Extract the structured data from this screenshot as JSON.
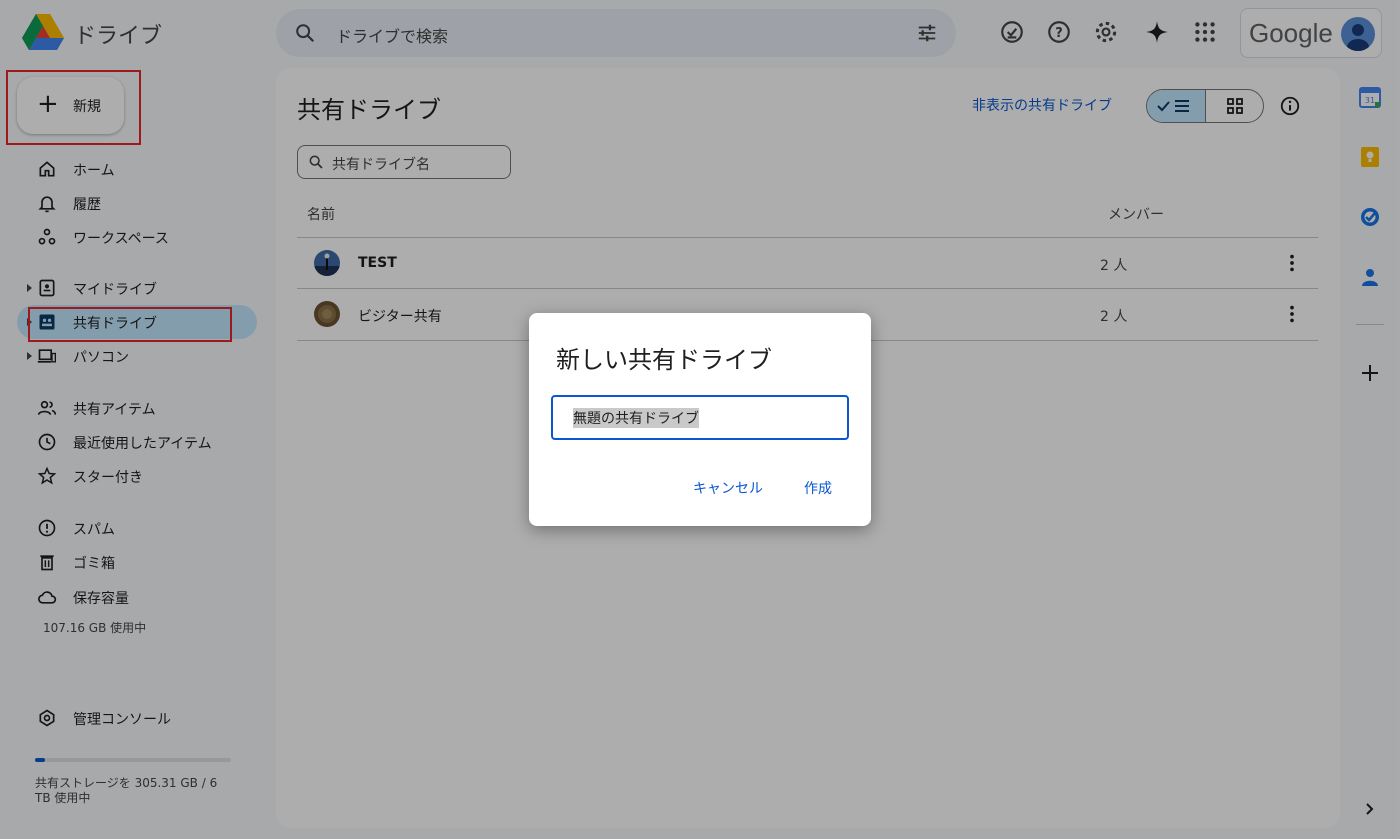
{
  "header": {
    "app_name": "ドライブ",
    "search_placeholder": "ドライブで検索",
    "account_logo_text": "Google",
    "icons": [
      "ready-for-offline-icon",
      "help-icon",
      "settings-icon",
      "gemini-sparkle-icon",
      "apps-grid-icon"
    ]
  },
  "sidebar": {
    "new_label": "新規",
    "items": [
      {
        "label": "ホーム",
        "icon": "home-icon"
      },
      {
        "label": "履歴",
        "icon": "bell-icon"
      },
      {
        "label": "ワークスペース",
        "icon": "workspaces-icon"
      },
      {
        "label": "マイドライブ",
        "icon": "my-drive-icon"
      },
      {
        "label": "共有ドライブ",
        "icon": "shared-drives-icon"
      },
      {
        "label": "パソコン",
        "icon": "computers-icon"
      },
      {
        "label": "共有アイテム",
        "icon": "people-icon"
      },
      {
        "label": "最近使用したアイテム",
        "icon": "clock-icon"
      },
      {
        "label": "スター付き",
        "icon": "star-icon"
      },
      {
        "label": "スパム",
        "icon": "spam-icon"
      },
      {
        "label": "ゴミ箱",
        "icon": "trash-icon"
      },
      {
        "label": "保存容量",
        "icon": "cloud-icon"
      },
      {
        "label": "管理コンソール",
        "icon": "admin-console-icon"
      }
    ],
    "storage_used": "107.16 GB 使用中",
    "shared_storage_text": "共有ストレージを 305.31 GB / 6 TB 使用中",
    "shared_storage_fraction": 0.05
  },
  "main": {
    "title": "共有ドライブ",
    "hidden_link": "非表示の共有ドライブ",
    "filter_placeholder": "共有ドライブ名",
    "columns": {
      "name": "名前",
      "members": "メンバー"
    },
    "rows": [
      {
        "name": "TEST",
        "members": "2 人"
      },
      {
        "name": "ビジター共有",
        "members": "2 人"
      }
    ]
  },
  "dialog": {
    "title": "新しい共有ドライブ",
    "input_value": "無題の共有ドライブ",
    "cancel_label": "キャンセル",
    "create_label": "作成"
  },
  "colors": {
    "accent": "#0b57d0",
    "active_nav": "#c2e7ff",
    "highlight_box": "#e8262a"
  }
}
